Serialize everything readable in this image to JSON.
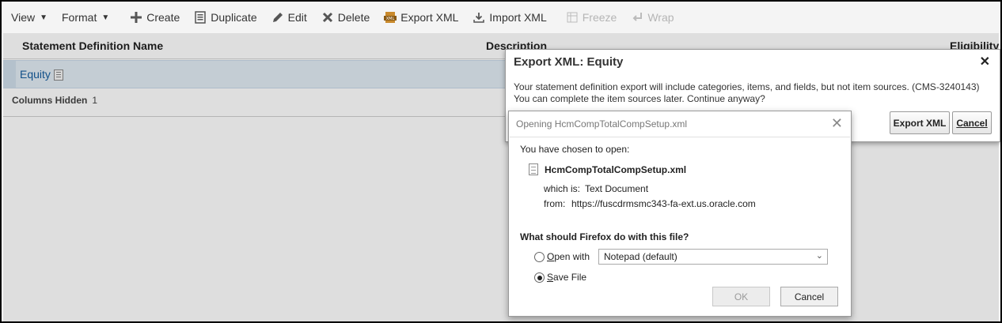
{
  "toolbar": {
    "view": "View",
    "format": "Format",
    "create": "Create",
    "duplicate": "Duplicate",
    "edit": "Edit",
    "delete": "Delete",
    "export_xml": "Export XML",
    "import_xml": "Import XML",
    "freeze": "Freeze",
    "wrap": "Wrap"
  },
  "table": {
    "columns": [
      "Statement Definition Name",
      "Description",
      "Eligibility"
    ],
    "rows": [
      {
        "name": "Equity"
      }
    ],
    "columns_hidden_label": "Columns Hidden",
    "columns_hidden_count": "1"
  },
  "export_dialog": {
    "title": "Export XML: Equity",
    "message_line1": "Your statement definition export will include categories, items, and fields, but not item sources. (CMS-3240143)",
    "message_line2": "You can complete the item sources later. Continue anyway?",
    "export_button": "Export XML",
    "cancel_button": "Cancel"
  },
  "firefox_dialog": {
    "title": "Opening HcmCompTotalCompSetup.xml",
    "chosen_text": "You have chosen to open:",
    "file_name": "HcmCompTotalCompSetup.xml",
    "which_is_label": "which is:",
    "which_is_value": "Text Document",
    "from_label": "from:",
    "from_value": "https://fuscdrmsmc343-fa-ext.us.oracle.com",
    "question": "What should Firefox do with this file?",
    "open_with_label": "pen with",
    "open_with_accel": "O",
    "open_with_value": "Notepad (default)",
    "save_file_label": "ave File",
    "save_file_accel": "S",
    "ok_button": "OK",
    "cancel_button": "Cancel"
  }
}
